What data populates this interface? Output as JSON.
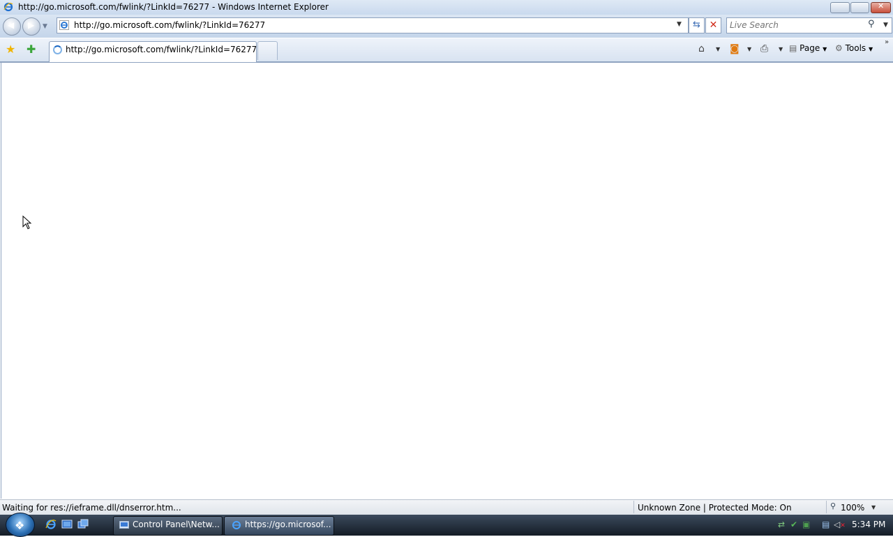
{
  "window": {
    "title": "http://go.microsoft.com/fwlink/?LinkId=76277 - Windows Internet Explorer"
  },
  "navbar": {
    "address": "http://go.microsoft.com/fwlink/?LinkId=76277",
    "search_placeholder": "Live Search"
  },
  "tabs": [
    {
      "label": "http://go.microsoft.com/fwlink/?LinkId=76277"
    }
  ],
  "commandbar": {
    "page_label": "Page",
    "tools_label": "Tools"
  },
  "statusbar": {
    "status": "Waiting for res://ieframe.dll/dnserror.htm...",
    "zone": "Unknown Zone | Protected Mode: On",
    "zoom": "100%"
  },
  "taskbar": {
    "tasks": [
      {
        "label": "Control Panel\\Netw..."
      },
      {
        "label": "https://go.microsof..."
      }
    ],
    "clock": "5:34 PM"
  },
  "icons": [
    "ie-icon",
    "back-icon",
    "forward-icon",
    "refresh-icon",
    "stop-icon",
    "search-icon",
    "favorites-star-icon",
    "add-favorites-icon",
    "home-icon",
    "feeds-icon",
    "print-icon",
    "page-icon",
    "tools-gear-icon",
    "zoom-icon",
    "start-orb-icon",
    "network-icon",
    "volume-muted-icon"
  ]
}
